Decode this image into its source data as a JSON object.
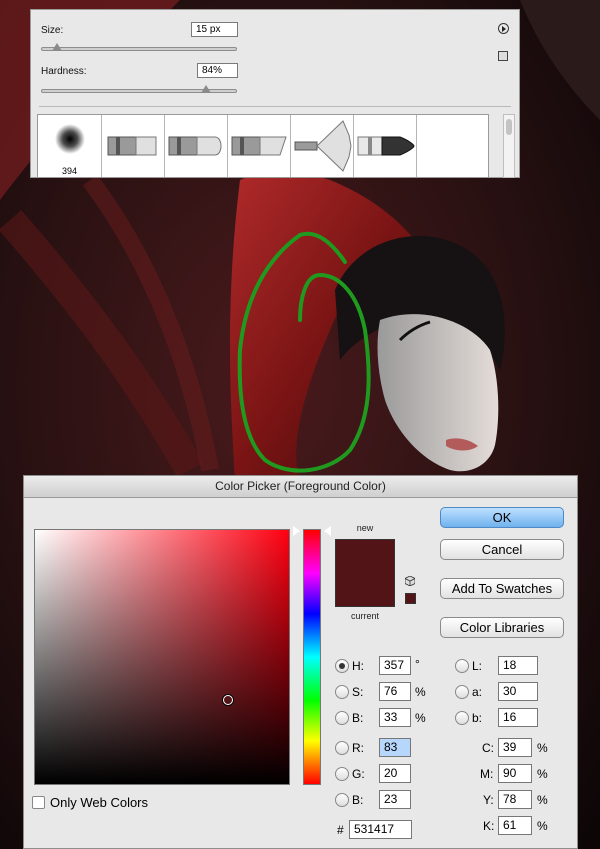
{
  "brush_panel": {
    "size_label": "Size:",
    "size_value": "15 px",
    "size_fraction": 0.08,
    "hardness_label": "Hardness:",
    "hardness_value": "84%",
    "hardness_fraction": 0.84,
    "first_brush_size": "394",
    "brushes": [
      "soft-round-brush-icon",
      "flat-brush-icon",
      "round-blunt-brush-icon",
      "angled-flat-brush-icon",
      "fan-brush-icon",
      "round-fine-brush-icon"
    ]
  },
  "color_picker": {
    "title": "Color Picker (Foreground Color)",
    "new_label": "new",
    "current_label": "current",
    "new_color": "#531417",
    "current_color": "#531417",
    "buttons": {
      "ok": "OK",
      "cancel": "Cancel",
      "add_to_swatches": "Add To Swatches",
      "color_libraries": "Color Libraries"
    },
    "hsb": {
      "h_label": "H:",
      "h_value": "357",
      "h_unit": "°",
      "s_label": "S:",
      "s_value": "76",
      "s_unit": "%",
      "b_label": "B:",
      "b_value": "33",
      "b_unit": "%"
    },
    "rgb": {
      "r_label": "R:",
      "r_value": "83",
      "g_label": "G:",
      "g_value": "20",
      "b_label": "B:",
      "b_value": "23"
    },
    "lab": {
      "l_label": "L:",
      "l_value": "18",
      "a_label": "a:",
      "a_value": "30",
      "b_label": "b:",
      "b_value": "16"
    },
    "cmyk": {
      "c_label": "C:",
      "c_value": "39",
      "c_unit": "%",
      "m_label": "M:",
      "m_value": "90",
      "m_unit": "%",
      "y_label": "Y:",
      "y_value": "78",
      "y_unit": "%",
      "k_label": "K:",
      "k_value": "61",
      "k_unit": "%"
    },
    "hex_label": "#",
    "hex_value": "531417",
    "only_web_colors": "Only Web Colors",
    "hue_color": "#ff0011",
    "saturation": 0.76,
    "brightness": 0.33,
    "hue_fraction": 0.008
  }
}
